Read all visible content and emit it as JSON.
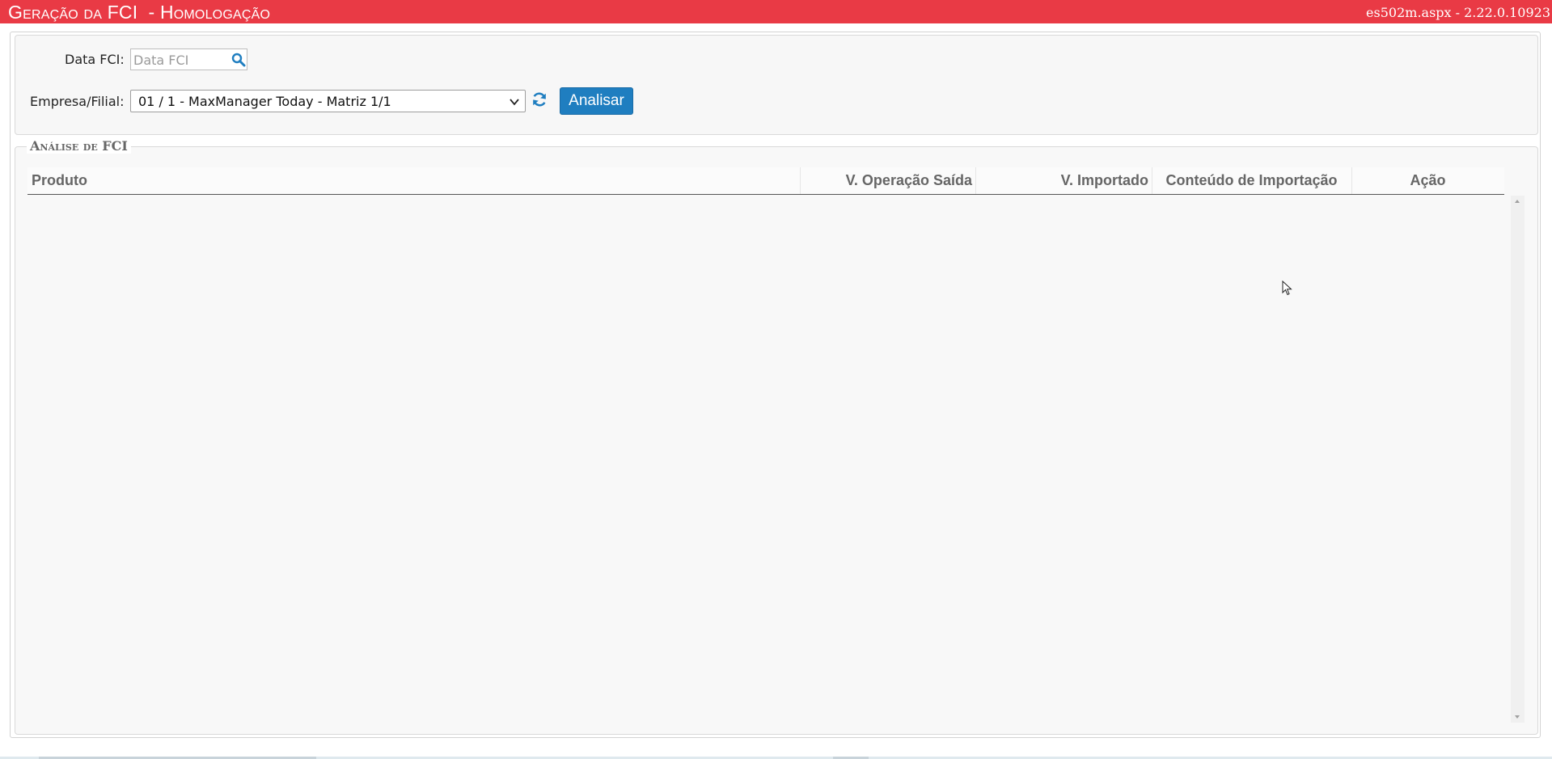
{
  "titlebar": {
    "title": "Geração da FCI  - Homologação",
    "version": "es502m.aspx - 2.22.0.10923",
    "color": "#e93a45"
  },
  "filters": {
    "date_label": "Data FCI:",
    "date_placeholder": "Data FCI",
    "date_value": "",
    "company_label": "Empresa/Filial:",
    "company_selected": "01 / 1 - MaxManager Today - Matriz 1/1",
    "analyze_label": "Analisar",
    "accent": "#1f7ec0"
  },
  "analysis": {
    "legend": "Análise de FCI",
    "columns": [
      "Produto",
      "V. Operação Saída",
      "V. Importado",
      "Conteúdo de Importação",
      "Ação"
    ],
    "rows": []
  },
  "icons": {
    "search": "search-icon",
    "chevron": "chevron-down-icon",
    "refresh": "refresh-icon",
    "cursor": "mouse-cursor-icon"
  }
}
